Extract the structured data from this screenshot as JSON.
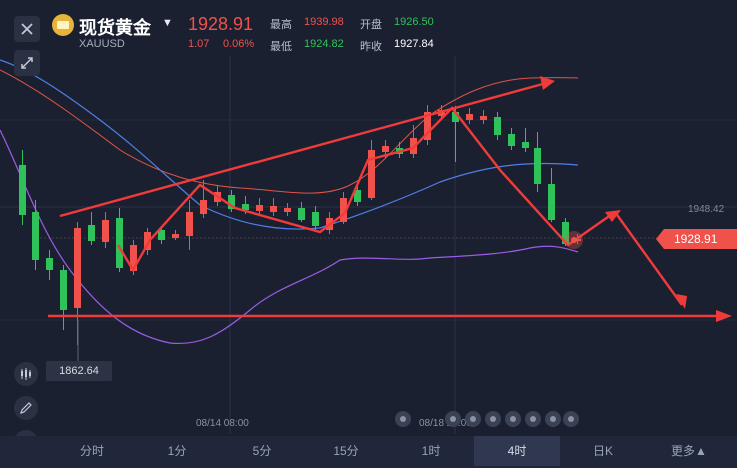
{
  "header": {
    "title": "现货黄金",
    "symbol": "XAUUSD",
    "price": "1928.91",
    "change": "1.07",
    "change_pct": "0.06%",
    "stats": {
      "high_label": "最高",
      "high_value": "1939.98",
      "open_label": "开盘",
      "open_value": "1926.50",
      "low_label": "最低",
      "low_value": "1924.82",
      "prev_close_label": "昨收",
      "prev_close_value": "1927.84"
    }
  },
  "chart": {
    "current_price_tag": "1928.91",
    "right_axis_label": "1948.42",
    "low_marker": "1862.64",
    "time_labels": [
      "08/14 08:00",
      "08/18 20:00"
    ]
  },
  "tabs": [
    {
      "label": "分时",
      "active": false
    },
    {
      "label": "1分",
      "active": false
    },
    {
      "label": "5分",
      "active": false
    },
    {
      "label": "15分",
      "active": false
    },
    {
      "label": "1时",
      "active": false
    },
    {
      "label": "4时",
      "active": true
    },
    {
      "label": "日K",
      "active": false
    },
    {
      "label": "更多▲",
      "active": false
    }
  ],
  "colors": {
    "up": "#f0524b",
    "down": "#2fc25b",
    "background": "#1b2030",
    "accent_arrow": "#f03b3b"
  },
  "icons": [
    "close-icon",
    "gold-logo-icon",
    "dropdown-caret-icon",
    "expand-icon",
    "candlestick-type-icon",
    "draw-pen-icon",
    "indicator-icon"
  ]
}
